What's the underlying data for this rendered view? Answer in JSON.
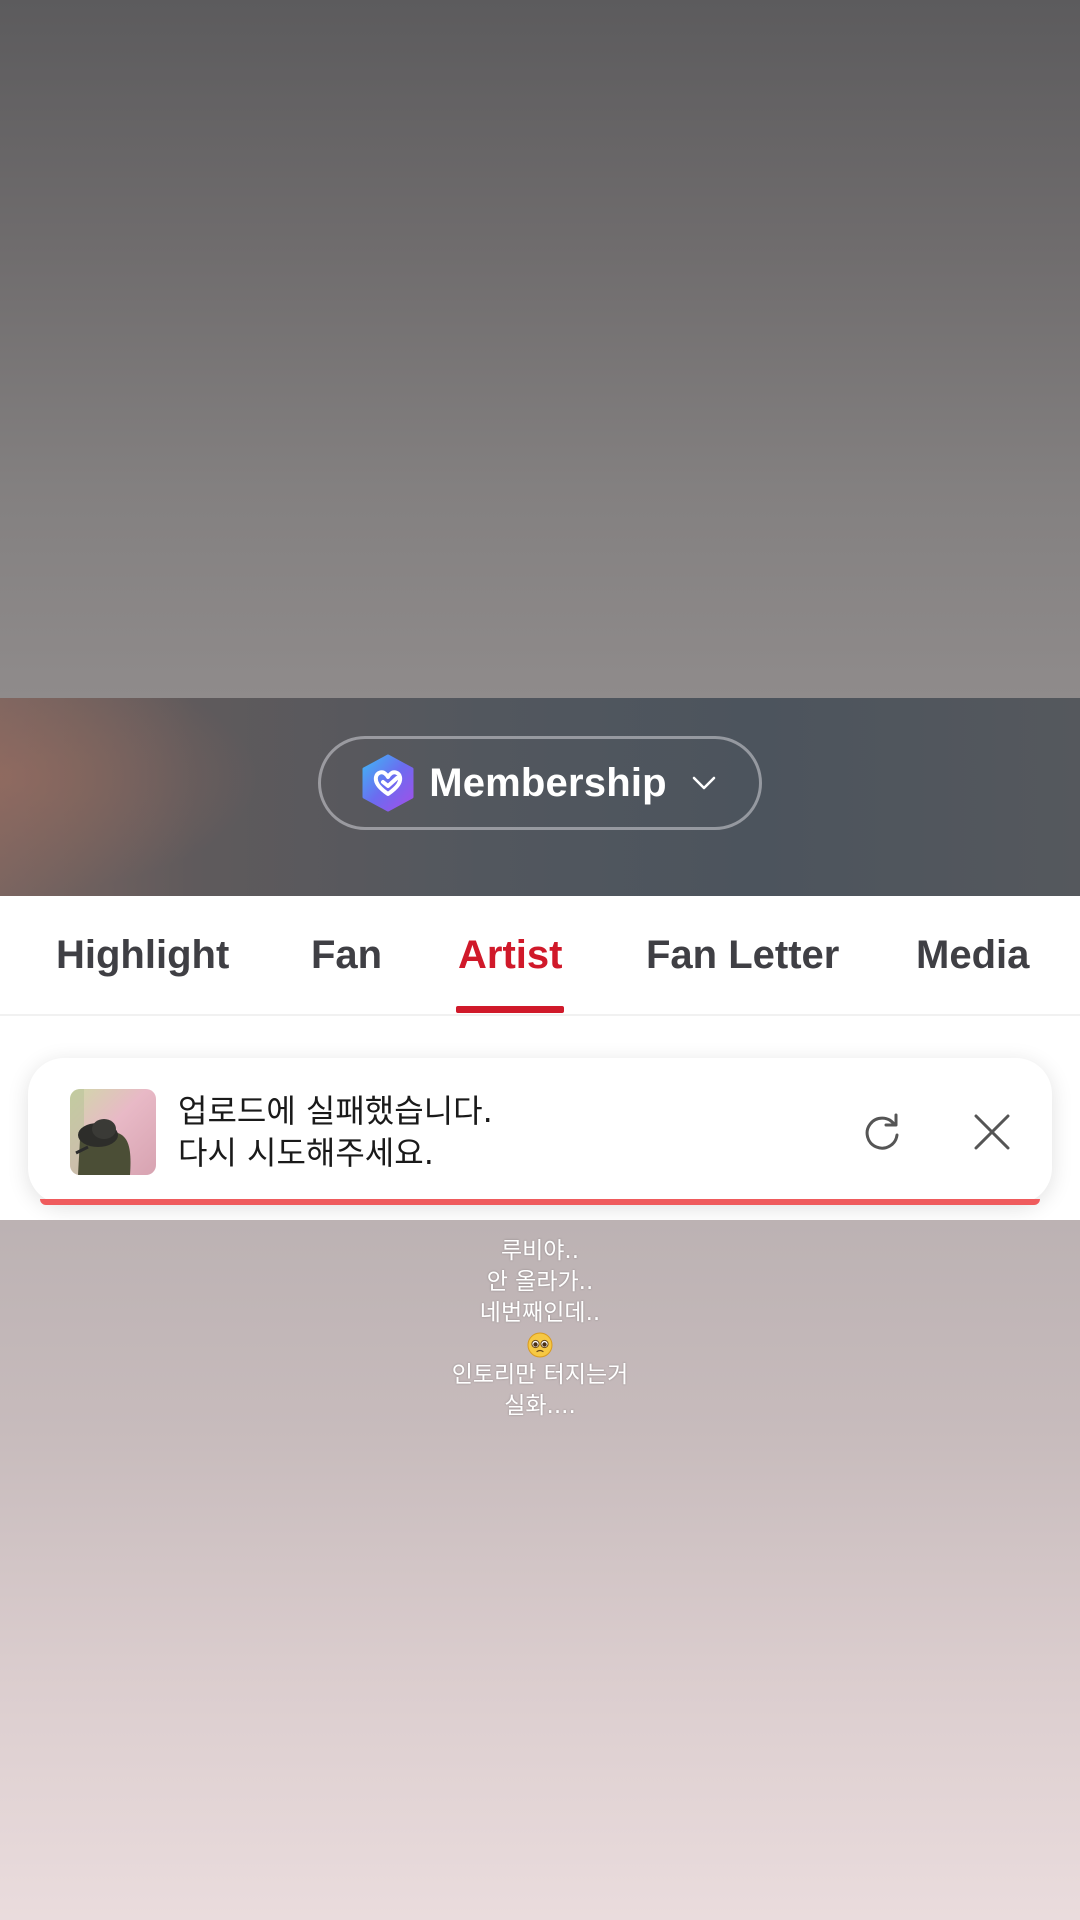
{
  "membership": {
    "label": "Membership",
    "logo_icon": "membership-heart-logo",
    "chevron_icon": "chevron-down-icon"
  },
  "tabs": {
    "items": [
      {
        "label": "Highlight",
        "active": false
      },
      {
        "label": "Fan",
        "active": false
      },
      {
        "label": "Artist",
        "active": true
      },
      {
        "label": "Fan Letter",
        "active": false
      },
      {
        "label": "Media",
        "active": false
      }
    ],
    "accent_color": "#d0192a"
  },
  "toast": {
    "line1": "업로드에 실패했습니다.",
    "line2": "다시 시도해주세요.",
    "retry_icon": "refresh-icon",
    "close_icon": "close-icon",
    "progress_color": "#ef5b5d"
  },
  "story": {
    "lines": [
      "루비야..",
      "안 올라가..",
      "네번째인데..",
      "",
      "인토리만 터지는거",
      "실화...."
    ],
    "emoji_icon": "pleading-face-emoji-icon"
  }
}
